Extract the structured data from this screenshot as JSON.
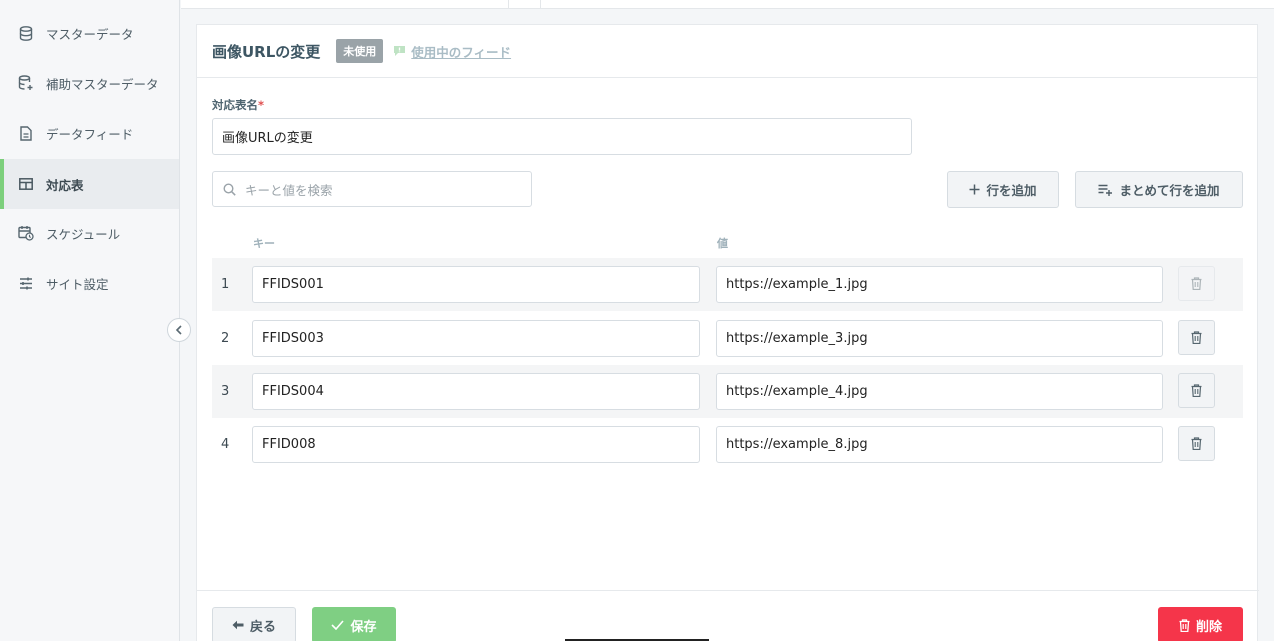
{
  "sidebar": {
    "items": [
      {
        "label": "マスターデータ",
        "icon": "database-icon"
      },
      {
        "label": "補助マスターデータ",
        "icon": "database-plus-icon"
      },
      {
        "label": "データフィード",
        "icon": "document-icon"
      },
      {
        "label": "対応表",
        "icon": "table-icon",
        "active": true
      },
      {
        "label": "スケジュール",
        "icon": "calendar-clock-icon"
      },
      {
        "label": "サイト設定",
        "icon": "sliders-icon"
      }
    ]
  },
  "header": {
    "title": "画像URLの変更",
    "badge": "未使用",
    "feed_link": "使用中のフィード"
  },
  "form": {
    "name_label": "対応表名",
    "required_mark": "*",
    "name_value": "画像URLの変更"
  },
  "search": {
    "placeholder": "キーと値を検索"
  },
  "toolbar": {
    "add_row": "行を追加",
    "bulk_add_rows": "まとめて行を追加"
  },
  "table": {
    "columns": {
      "key": "キー",
      "value": "値"
    },
    "rows": [
      {
        "index": "1",
        "key": "FFIDS001",
        "value": "https://example_1.jpg",
        "delete_disabled": true
      },
      {
        "index": "2",
        "key": "FFIDS003",
        "value": "https://example_3.jpg",
        "delete_disabled": false
      },
      {
        "index": "3",
        "key": "FFIDS004",
        "value": "https://example_4.jpg",
        "delete_disabled": false
      },
      {
        "index": "4",
        "key": "FFID008",
        "value": "https://example_8.jpg",
        "delete_disabled": false
      }
    ]
  },
  "footer": {
    "back": "戻る",
    "save": "保存",
    "delete": "削除"
  },
  "colors": {
    "accent_green": "#7fcf83",
    "danger_red": "#f5354a",
    "active_bar": "#7ccf7c"
  }
}
